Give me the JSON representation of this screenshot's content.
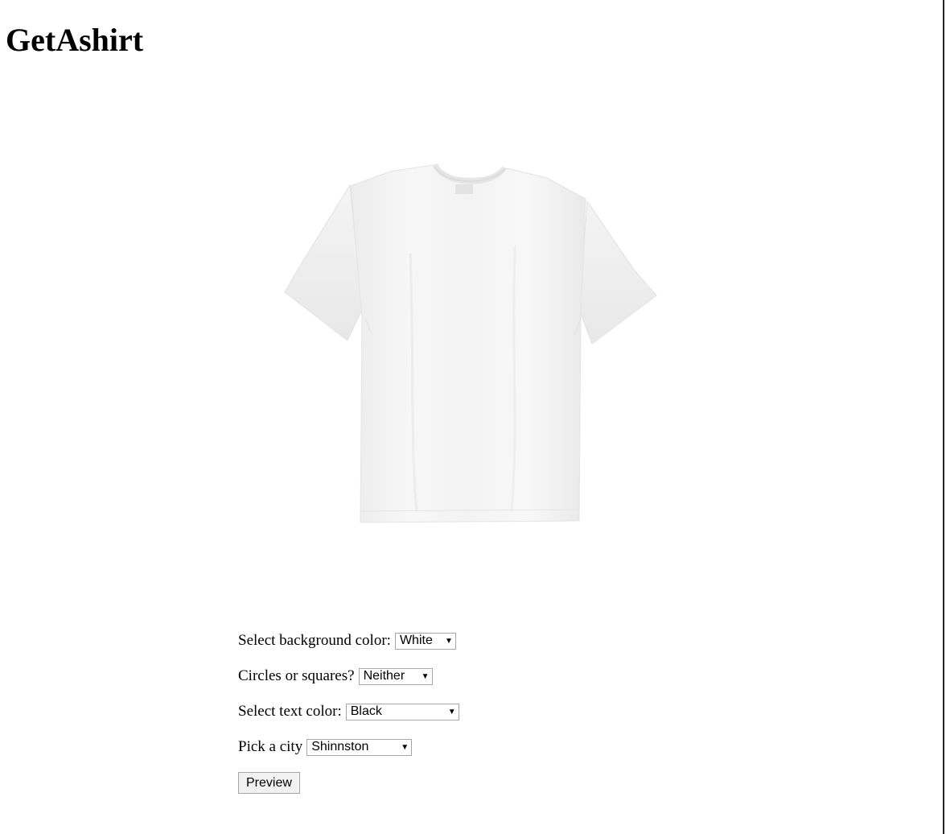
{
  "header": {
    "title": "GetAshirt"
  },
  "preview": {
    "image": "white-tshirt",
    "shirt_color": "#f5f5f5"
  },
  "form": {
    "background": {
      "label": "Select background color:",
      "selected": "White"
    },
    "shapes": {
      "label": "Circles or squares?",
      "selected": "Neither"
    },
    "text_color": {
      "label": "Select text color:",
      "selected": "Black"
    },
    "city": {
      "label": "Pick a city",
      "selected": "Shinnston"
    },
    "preview_button": "Preview"
  },
  "icons": {
    "dropdown": "chevron-down-icon"
  }
}
